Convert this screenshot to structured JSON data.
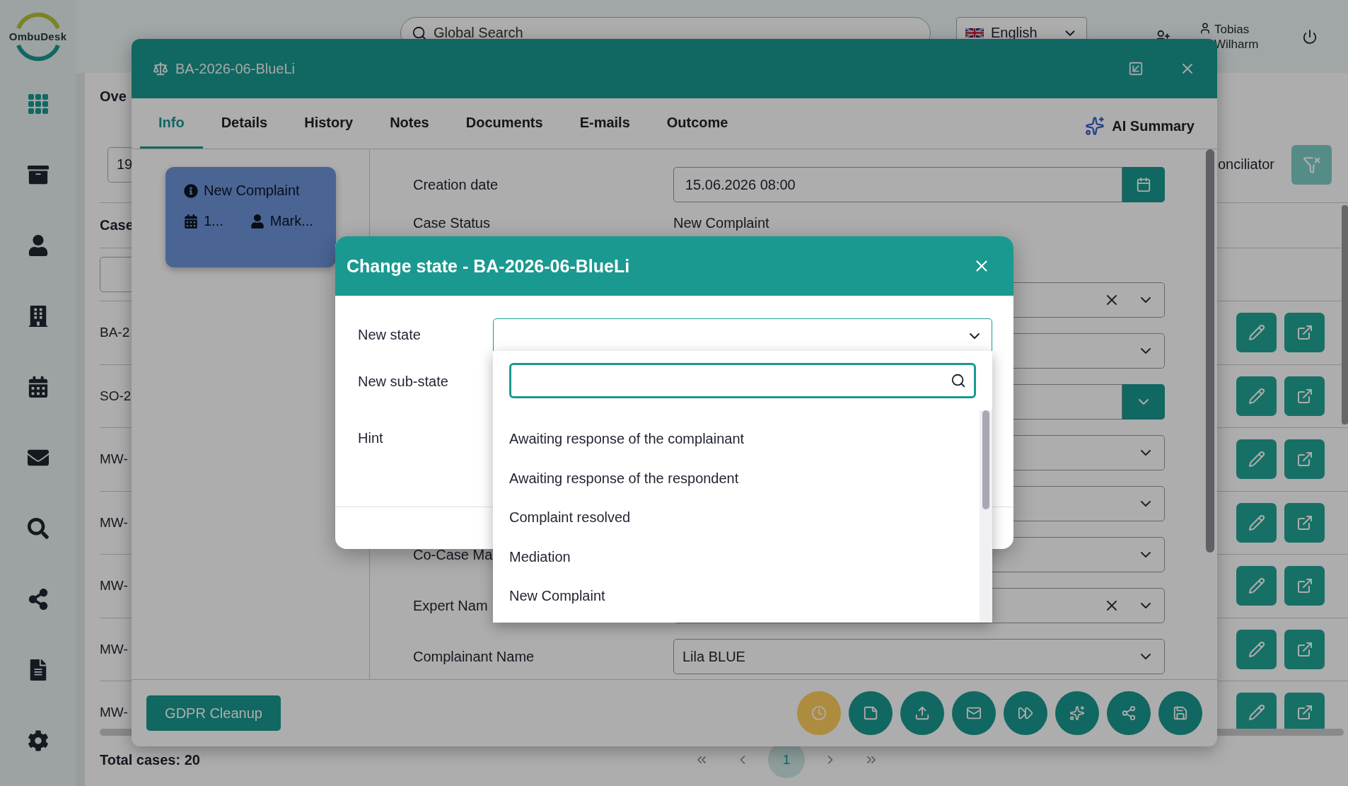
{
  "logo": {
    "text": "OmbuDesk"
  },
  "top_bar": {
    "search": {
      "placeholder": "Global Search"
    },
    "language": {
      "label": "English"
    },
    "user": {
      "name": "Tobias Wilharm"
    }
  },
  "sidebar": {
    "items": [
      {
        "kind": "apps",
        "selected": true
      },
      {
        "kind": "archive",
        "selected": false
      },
      {
        "kind": "person",
        "selected": false
      },
      {
        "kind": "building",
        "selected": false
      },
      {
        "kind": "calendar",
        "selected": false
      },
      {
        "kind": "mail",
        "selected": false
      },
      {
        "kind": "search",
        "selected": false
      },
      {
        "kind": "share",
        "selected": false
      },
      {
        "kind": "document",
        "selected": false
      },
      {
        "kind": "settings",
        "selected": false
      }
    ]
  },
  "overview": {
    "title": "Ove",
    "date_filter": {
      "value": "19"
    },
    "column_1": "Case",
    "column_right": "onciliator",
    "rows": [
      {
        "case": "BA-2"
      },
      {
        "case": "SO-2"
      },
      {
        "case": "MW-"
      },
      {
        "case": "MW-"
      },
      {
        "case": "MW-"
      },
      {
        "case": "MW-"
      },
      {
        "case": "MW-"
      }
    ],
    "total": "Total cases: 20",
    "pagination": {
      "pages": [
        {
          "label": "1",
          "selected": true
        }
      ]
    }
  },
  "case_modal": {
    "title": "BA-2026-06-BlueLi",
    "tabs": [
      {
        "label": "Info",
        "selected": true
      },
      {
        "label": "Details",
        "selected": false
      },
      {
        "label": "History",
        "selected": false
      },
      {
        "label": "Notes",
        "selected": false
      },
      {
        "label": "Documents",
        "selected": false
      },
      {
        "label": "E-mails",
        "selected": false
      },
      {
        "label": "Outcome",
        "selected": false
      }
    ],
    "ai_summary": "AI Summary",
    "card": {
      "status": "New Complaint",
      "date": "1...",
      "assignee": "Mark..."
    },
    "fields": [
      {
        "kind": "date",
        "label": "Creation date",
        "value": "15.06.2026 08:00"
      },
      {
        "kind": "text",
        "label": "Case Status",
        "value": "New Complaint"
      },
      {
        "kind": "select",
        "clearable": true
      },
      {
        "kind": "select",
        "clearable": false
      },
      {
        "kind": "select_button",
        "clearable": false
      },
      {
        "kind": "select",
        "clearable": false
      },
      {
        "kind": "select",
        "clearable": false
      },
      {
        "kind": "select",
        "label": "Co-Case Ma",
        "clearable": false
      },
      {
        "kind": "select",
        "label": "Expert Nam",
        "clearable": true
      },
      {
        "kind": "select",
        "label": "Complainant Name",
        "value": "Lila BLUE",
        "clearable": false
      }
    ],
    "gdpr_button": "GDPR Cleanup",
    "actions": [
      {
        "kind": "clock",
        "highlighted": true
      },
      {
        "kind": "note",
        "highlighted": false
      },
      {
        "kind": "upload",
        "highlighted": false
      },
      {
        "kind": "mail",
        "highlighted": false
      },
      {
        "kind": "forward",
        "highlighted": false
      },
      {
        "kind": "ai",
        "highlighted": false
      },
      {
        "kind": "share",
        "highlighted": false
      },
      {
        "kind": "save",
        "highlighted": false
      }
    ]
  },
  "dialog": {
    "title": "Change state - BA-2026-06-BlueLi",
    "fields": [
      {
        "label": "New state"
      },
      {
        "label": "New sub-state"
      },
      {
        "label": "Hint"
      }
    ],
    "dropdown": {
      "options": [
        "Awaiting response of the complainant",
        "Awaiting response of the respondent",
        "Complaint resolved",
        "Mediation",
        "New Complaint"
      ]
    }
  }
}
